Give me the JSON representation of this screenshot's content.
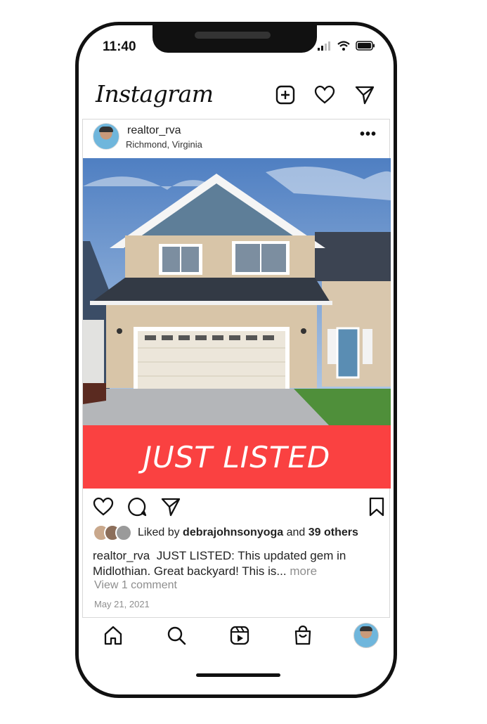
{
  "status_bar": {
    "time": "11:40"
  },
  "header": {
    "logo": "Instagram",
    "icons": [
      "new-post-icon",
      "heart-icon",
      "direct-message-icon"
    ]
  },
  "post": {
    "username": "realtor_rva",
    "location": "Richmond, Virginia",
    "banner_text": "JUST LISTED",
    "likes": {
      "prefix": "Liked by",
      "user": "debrajohnsonyoga",
      "joiner": "and",
      "others": "39 others"
    },
    "caption": {
      "username": "realtor_rva",
      "text": "JUST LISTED: This updated gem in Midlothian. Great backyard! This is...",
      "more": "more"
    },
    "view_comments": "View 1 comment",
    "date": "May 21, 2021"
  },
  "colors": {
    "banner": "#fa4141",
    "muted_text": "#8e8e8e"
  }
}
